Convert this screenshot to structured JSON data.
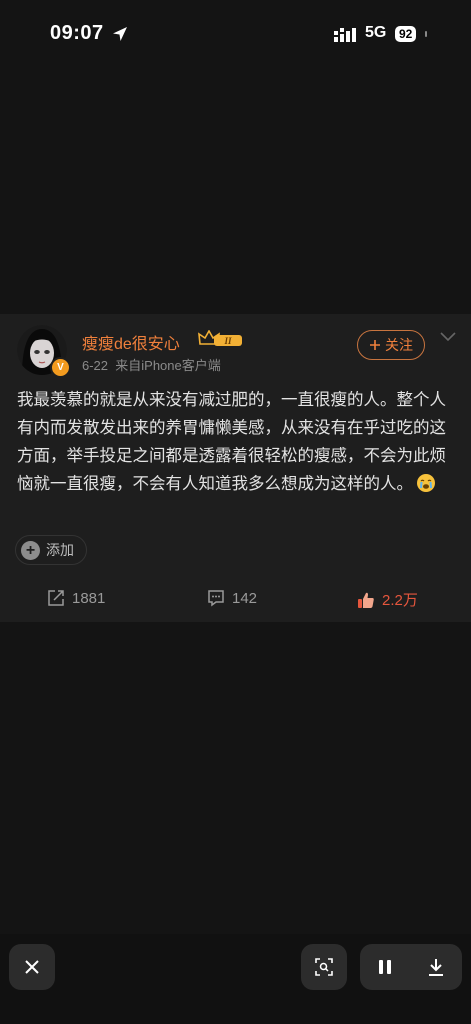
{
  "status": {
    "time": "09:07",
    "network": "5G",
    "battery": "92"
  },
  "post": {
    "username": "瘦瘦de很安心",
    "verified_badge": "V",
    "level_badge": "II",
    "date": "6-22",
    "source": "来自iPhone客户端",
    "follow_label": "关注",
    "text": "我最羡慕的就是从来没有减过肥的，一直很瘦的人。整个人有内而发散发出来的养胃慵懒美感，从来没有在乎过吃的这方面，举手投足之间都是透露着很轻松的瘦感，不会为此烦恼就一直很瘦，不会有人知道我多么想成为这样的人。",
    "emoji": "crying-face-emoji",
    "add_label": "添加",
    "reposts": "1881",
    "comments": "142",
    "likes": "2.2万"
  },
  "colors": {
    "accent": "#f0803c",
    "like": "#e6563d",
    "background": "#141414",
    "card": "#1e1e1e"
  }
}
